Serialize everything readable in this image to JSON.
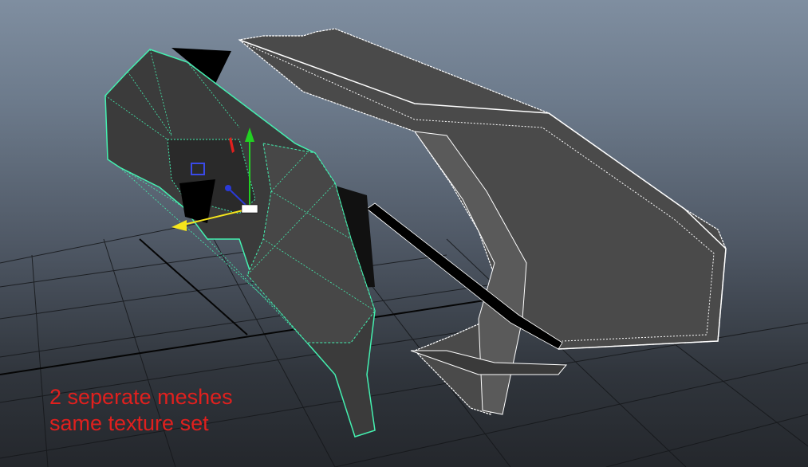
{
  "viewport": {
    "background_top": "#7f8ea0",
    "background_bottom": "#24272c",
    "grid_color": "#141619",
    "grid_axis_color": "#000000"
  },
  "meshes": [
    {
      "name": "bumper-mesh-selected",
      "wire_color": "#44f0b0",
      "fill": "#3b3b3b",
      "selected": true
    },
    {
      "name": "frame-mesh-unselected",
      "wire_color": "#ffffff",
      "fill": "#474747",
      "selected": false
    }
  ],
  "gizmo": {
    "type": "move-manipulator",
    "x_axis_color": "#f5e51c",
    "y_axis_color": "#22d022",
    "z_axis_color": "#2a3ad8",
    "center_color": "#e0201e"
  },
  "annotation": {
    "line1": "2 seperate meshes",
    "line2": "same texture set",
    "color": "#e0201e"
  }
}
